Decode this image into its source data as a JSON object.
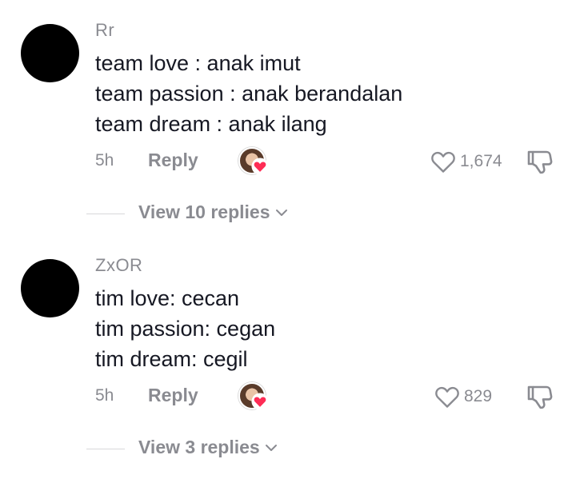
{
  "comments": [
    {
      "username": "Rr",
      "lines": [
        "team love : anak imut",
        "team passion : anak berandalan",
        "team dream : anak ilang"
      ],
      "time": "5h",
      "reply_label": "Reply",
      "like_count": "1,674",
      "view_replies": "View 10 replies"
    },
    {
      "username": "ZxOR",
      "lines": [
        "tim love: cecan",
        "tim passion: cegan",
        "tim dream: cegil"
      ],
      "time": "5h",
      "reply_label": "Reply",
      "like_count": "829",
      "view_replies": "View 3 replies"
    }
  ],
  "icons": {
    "like": "heart-outline-icon",
    "dislike": "thumbs-down-icon",
    "creator_liked": "creator-liked-heart-icon",
    "expand": "chevron-down-icon"
  },
  "colors": {
    "text": "#161823",
    "secondary": "#8a8b91",
    "heart": "#fe2c55"
  }
}
